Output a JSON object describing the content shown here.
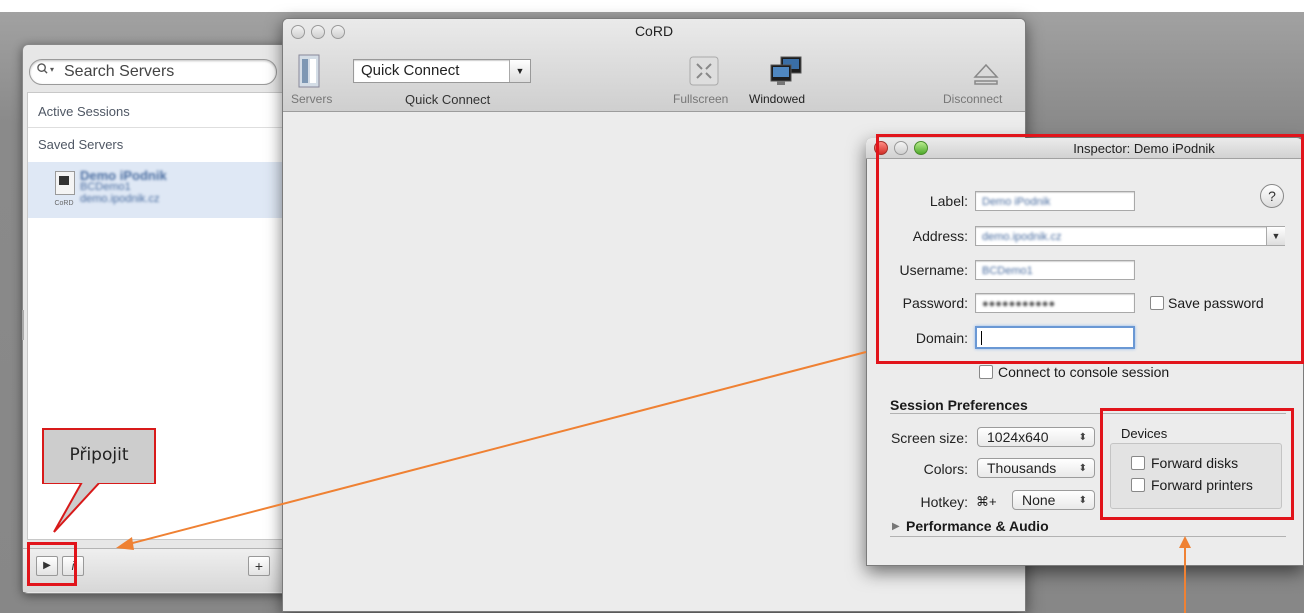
{
  "drawer": {
    "search_placeholder": "Search Servers",
    "active_sessions": "Active Sessions",
    "saved_servers": "Saved Servers",
    "server": {
      "name": "Demo iPodnik",
      "username": "BCDemo1",
      "address": "demo.ipodnik.cz",
      "icon_caption": "CoRD"
    },
    "connect_btn": "▶",
    "info_btn": "i",
    "add_btn": "+"
  },
  "window": {
    "title": "CoRD",
    "toolbar": {
      "servers": "Servers",
      "quick_connect_value": "Quick Connect",
      "quick_connect_label": "Quick Connect",
      "fullscreen": "Fullscreen",
      "windowed": "Windowed",
      "disconnect": "Disconnect"
    }
  },
  "inspector": {
    "title": "Inspector: Demo iPodnik",
    "label_label": "Label:",
    "label_value": "Demo iPodnik",
    "address_label": "Address:",
    "address_value": "demo.ipodnik.cz",
    "username_label": "Username:",
    "username_value": "BCDemo1",
    "password_label": "Password:",
    "password_value": "●●●●●●●●●●●",
    "save_password": "Save password",
    "domain_label": "Domain:",
    "domain_value": "",
    "console_session": "Connect to console session",
    "session_prefs": "Session Preferences",
    "screen_size_label": "Screen size:",
    "screen_size_value": "1024x640",
    "colors_label": "Colors:",
    "colors_value": "Thousands",
    "hotkey_label": "Hotkey:",
    "hotkey_prefix": "⌘+",
    "hotkey_value": "None",
    "devices_label": "Devices",
    "forward_disks": "Forward disks",
    "forward_printers": "Forward printers",
    "performance": "Performance & Audio",
    "help": "?"
  },
  "annotation": {
    "callout": "Připojit",
    "accent": "#e1141b",
    "arrow_color": "#ef8133"
  }
}
